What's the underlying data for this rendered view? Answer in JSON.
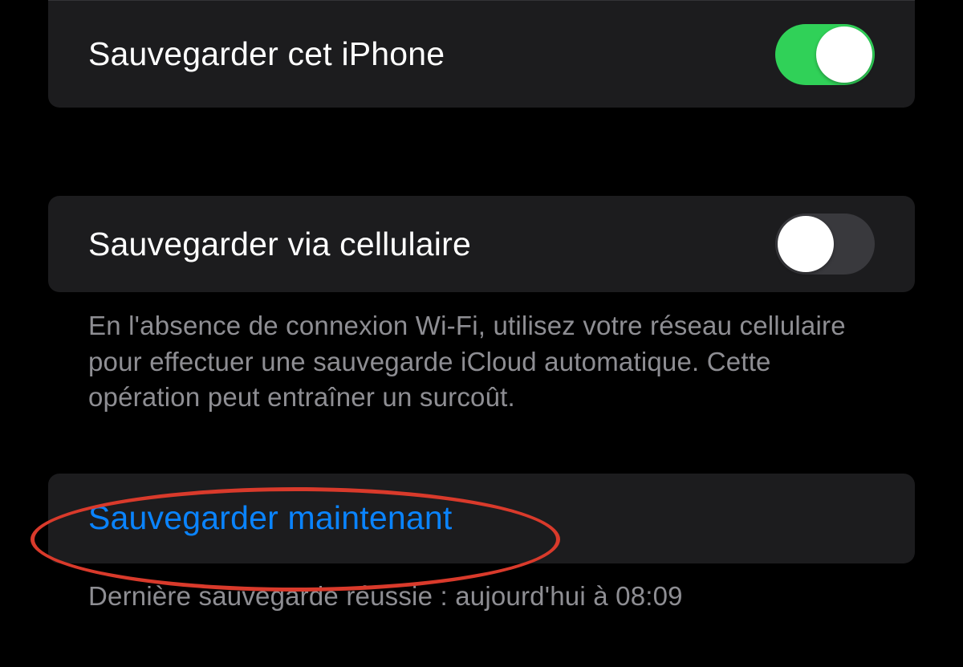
{
  "backup_iphone": {
    "label": "Sauvegarder cet iPhone",
    "enabled": true
  },
  "backup_cellular": {
    "label": "Sauvegarder via cellulaire",
    "enabled": false,
    "description": "En l'absence de connexion Wi-Fi, utilisez votre réseau cellulaire pour effectuer une sauvegarde iCloud automatique. Cette opération peut entraîner un surcoût."
  },
  "backup_now": {
    "label": "Sauvegarder maintenant",
    "status": "Dernière sauvegarde réussie : aujourd'hui à 08:09"
  }
}
